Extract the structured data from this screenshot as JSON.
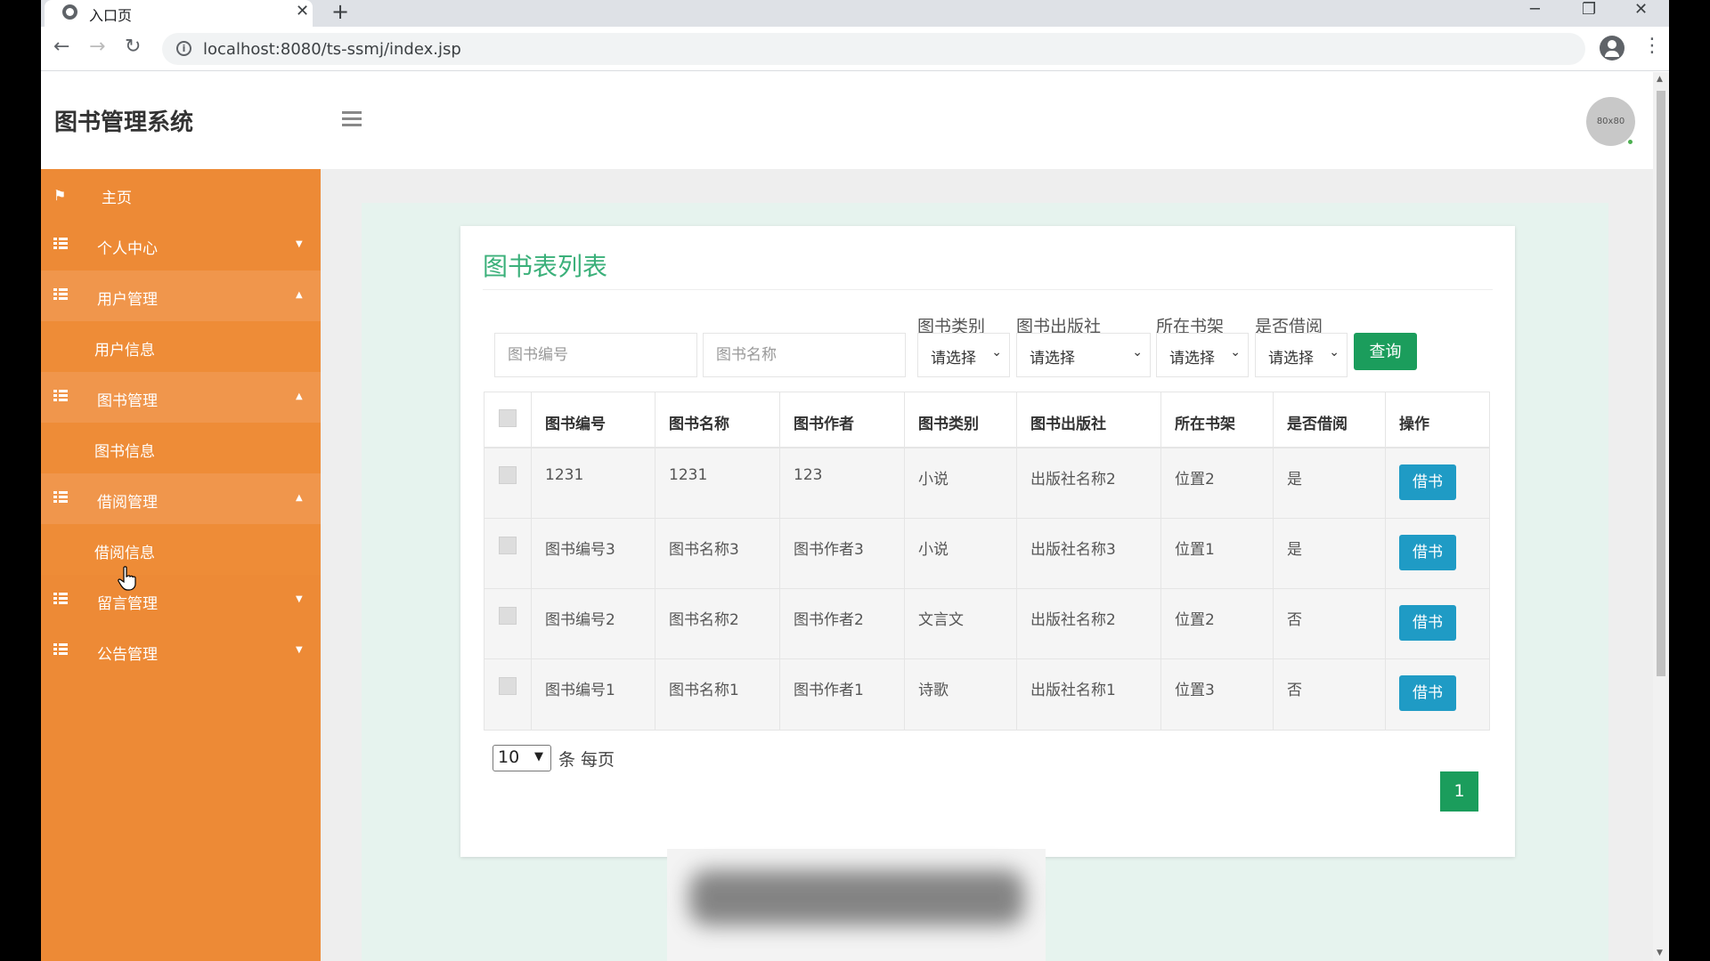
{
  "browser": {
    "tab_title": "入口页",
    "tab_close": "✕",
    "new_tab": "+",
    "url": "localhost:8080/ts-ssmj/index.jsp",
    "window_controls": {
      "minimize": "─",
      "restore": "❐",
      "close": "✕"
    }
  },
  "app": {
    "title": "图书管理系统",
    "avatar_text": "80x80"
  },
  "sidebar": {
    "items": [
      {
        "label": "主页",
        "icon": "flag-icon"
      },
      {
        "label": "个人中心",
        "icon": "grid-icon",
        "caret": "▼"
      },
      {
        "label": "用户管理",
        "icon": "grid-icon",
        "caret": "▲"
      },
      {
        "label": "用户信息"
      },
      {
        "label": "图书管理",
        "icon": "grid-icon",
        "caret": "▲"
      },
      {
        "label": "图书信息"
      },
      {
        "label": "借阅管理",
        "icon": "grid-icon",
        "caret": "▲"
      },
      {
        "label": "借阅信息"
      },
      {
        "label": "留言管理",
        "icon": "grid-icon",
        "caret": "▼"
      },
      {
        "label": "公告管理",
        "icon": "grid-icon",
        "caret": "▼"
      }
    ]
  },
  "main": {
    "title": "图书表列表",
    "filters": {
      "book_no_placeholder": "图书编号",
      "book_name_placeholder": "图书名称",
      "category_label": "图书类别",
      "publisher_label": "图书出版社",
      "shelf_label": "所在书架",
      "borrowed_label": "是否借阅",
      "select_default": "请选择",
      "query_button": "查询"
    },
    "table": {
      "headers": [
        "图书编号",
        "图书名称",
        "图书作者",
        "图书类别",
        "图书出版社",
        "所在书架",
        "是否借阅",
        "操作"
      ],
      "rows": [
        [
          "1231",
          "1231",
          "123",
          "小说",
          "出版社名称2",
          "位置2",
          "是"
        ],
        [
          "图书编号3",
          "图书名称3",
          "图书作者3",
          "小说",
          "出版社名称3",
          "位置1",
          "是"
        ],
        [
          "图书编号2",
          "图书名称2",
          "图书作者2",
          "文言文",
          "出版社名称2",
          "位置2",
          "否"
        ],
        [
          "图书编号1",
          "图书名称1",
          "图书作者1",
          "诗歌",
          "出版社名称1",
          "位置3",
          "否"
        ]
      ],
      "action_label": "借书"
    },
    "pagination": {
      "page_size": "10",
      "per_page_text": "条 每页",
      "current_page": "1"
    }
  },
  "colors": {
    "sidebar": "#ed8a36",
    "accent_green": "#1b9d5c",
    "title_green": "#3bb07a",
    "action_blue": "#1f9bc5"
  }
}
